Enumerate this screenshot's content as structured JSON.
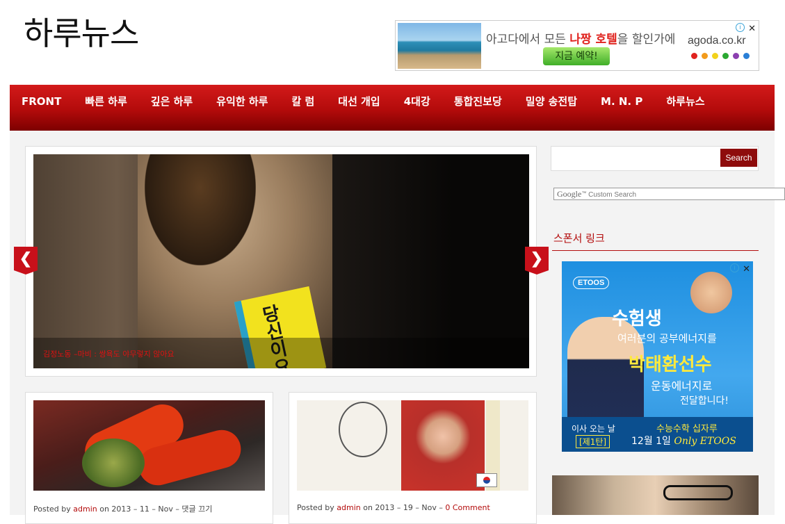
{
  "site": {
    "title": "하루뉴스"
  },
  "top_ad": {
    "text_pre": "아고다에서 모든 ",
    "text_hl": "나짱 호텔",
    "text_post": "을 할인가에",
    "button": "지금 예약!",
    "brand": "agoda.co.kr",
    "dot_colors": [
      "#e0231e",
      "#f29b1c",
      "#f2d21c",
      "#2aa832",
      "#8b3fb0",
      "#2a7fd6"
    ],
    "close_icon": "✕",
    "info_icon": "i"
  },
  "nav": {
    "items": [
      "FRONT",
      "빠른 하루",
      "깊은 하루",
      "유익한 하루",
      "칼 럼",
      "대선 개입",
      "4대강",
      "통합진보당",
      "밀양 송전탑",
      "M. N. P",
      "하루뉴스"
    ]
  },
  "slider": {
    "caption": "김정노동 –마비 : 쌍욕도 야무렇지 않아요",
    "sign_text": "당신이요",
    "prev": "❮",
    "next": "❯"
  },
  "posts": [
    {
      "posted_by": "Posted by ",
      "author": "admin",
      "date": " on 2013 – 11 – Nov – ",
      "comments": "댓글 끄기",
      "comments_red": false
    },
    {
      "posted_by": "Posted by ",
      "author": "admin",
      "date": " on 2013 – 19 – Nov – ",
      "comments": "0 Comment",
      "comments_red": true
    }
  ],
  "sidebar": {
    "search_button": "Search",
    "google_label": "Google",
    "google_placeholder": "Custom Search",
    "sponsor_title": "스폰서 링크",
    "ad": {
      "brand": "ETOOS",
      "line1": "수험생",
      "line2": "여러분의 공부에너지를",
      "line3": "박태환선수",
      "line4": "운동에너지로",
      "line5": "전달합니다!",
      "bottom_left": "이사 오는 날",
      "bottom_tag": "[제1탄]",
      "bottom_right": "수능수학 십자루",
      "bottom_date": "12월 1일 ",
      "bottom_brand": "Only ETOOS"
    }
  },
  "colors": {
    "accent": "#b30b0b",
    "nav_top": "#d31a1a",
    "nav_bottom": "#7d0000"
  }
}
